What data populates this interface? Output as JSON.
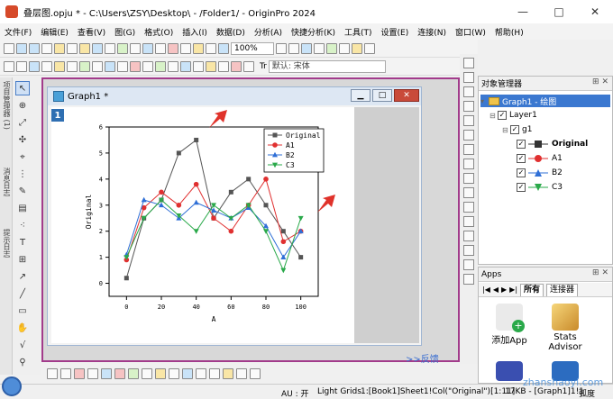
{
  "window": {
    "title": "叠层图.opju * - C:\\Users\\ZSY\\Desktop\\ - /Folder1/ - OriginPro 2024",
    "buttons": [
      "—",
      "□",
      "✕"
    ]
  },
  "menu": [
    "文件(F)",
    "编辑(E)",
    "查看(V)",
    "图(G)",
    "格式(O)",
    "插入(I)",
    "数据(D)",
    "分析(A)",
    "快捷分析(K)",
    "工具(T)",
    "设置(E)",
    "连接(N)",
    "窗口(W)",
    "帮助(H)"
  ],
  "toolbar": {
    "zoom": "100%",
    "font_prefix": "Tr",
    "font_name": "默认: 宋体"
  },
  "left_tabs": [
    "项目管理器 (1)",
    "消息日志",
    "提示日志"
  ],
  "graph_window": {
    "title": "Graph1 *",
    "layer_number": "1"
  },
  "chart_data": {
    "type": "line",
    "xlabel": "A",
    "ylabel": "Original",
    "xlim": [
      -10,
      110
    ],
    "ylim": [
      -0.5,
      6
    ],
    "xticks": [
      "0",
      "20",
      "40",
      "60",
      "80",
      "100"
    ],
    "yticks": [
      "0",
      "1",
      "2",
      "3",
      "4",
      "5",
      "6"
    ],
    "x": [
      0,
      10,
      20,
      30,
      40,
      50,
      60,
      70,
      80,
      90,
      100
    ],
    "legend_position": "top-right",
    "series": [
      {
        "name": "Original",
        "color": "#555555",
        "marker": "square",
        "values": [
          0.2,
          2.5,
          3.2,
          5.0,
          5.5,
          2.5,
          3.5,
          4.0,
          3.0,
          2.0,
          1.0
        ]
      },
      {
        "name": "A1",
        "color": "#e03030",
        "marker": "circle",
        "values": [
          0.9,
          2.9,
          3.5,
          3.0,
          3.8,
          2.5,
          2.0,
          3.0,
          4.0,
          1.6,
          2.0
        ]
      },
      {
        "name": "B2",
        "color": "#2f6fd6",
        "marker": "triangle-up",
        "values": [
          1.1,
          3.2,
          3.0,
          2.5,
          3.1,
          2.8,
          2.5,
          2.9,
          2.2,
          1.0,
          2.0
        ]
      },
      {
        "name": "C3",
        "color": "#2aa94a",
        "marker": "triangle-down",
        "values": [
          1.0,
          2.5,
          3.2,
          2.6,
          2.0,
          3.0,
          2.5,
          3.0,
          2.0,
          0.5,
          2.5
        ]
      }
    ]
  },
  "feedback_link": ">>反馈",
  "object_manager": {
    "title": "对象管理器",
    "items": [
      {
        "label": "Graph1 - 绘图",
        "level": 0,
        "selected": true
      },
      {
        "label": "Layer1",
        "level": 1
      },
      {
        "label": "g1",
        "level": 2
      },
      {
        "label": "Original",
        "level": 3,
        "bold": true,
        "color": "#333333"
      },
      {
        "label": "A1",
        "level": 3,
        "color": "#e03030"
      },
      {
        "label": "B2",
        "level": 3,
        "color": "#2f6fd6"
      },
      {
        "label": "C3",
        "level": 3,
        "color": "#2aa94a"
      }
    ]
  },
  "apps": {
    "title": "Apps",
    "tabs": [
      "所有",
      "连接器"
    ],
    "tiles": [
      "添加App",
      "Stats Advisor"
    ]
  },
  "status": {
    "au": "AU : 开",
    "grids": "Light Grids",
    "cell": "1:[Book1]Sheet1!Col(\"Original\")[1:11]",
    "size": "17KB - [Graph1]1!1",
    "unit": "弧度"
  },
  "watermark": "zhanshaoyi.com"
}
